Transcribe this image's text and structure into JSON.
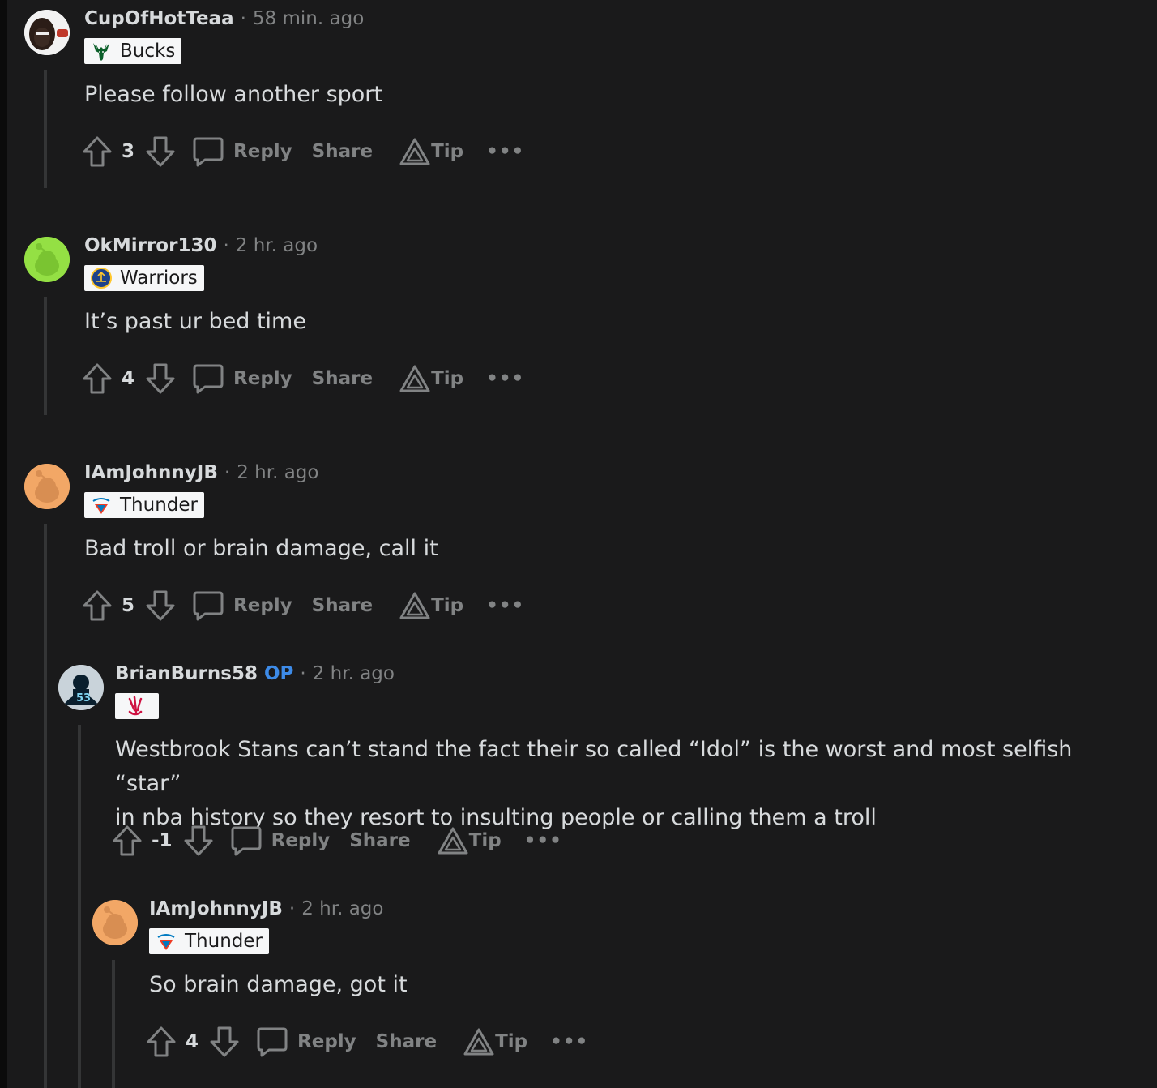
{
  "comments": [
    {
      "username": "CupOfHotTeaa",
      "time": "58 min. ago",
      "flair": "Bucks",
      "body": "Please follow another sport",
      "score": "3",
      "actions": {
        "reply": "Reply",
        "share": "Share",
        "tip": "Tip",
        "more": "•••"
      }
    },
    {
      "username": "OkMirror130",
      "time": "2 hr. ago",
      "flair": "Warriors",
      "body": "It’s past ur bed time",
      "score": "4",
      "actions": {
        "reply": "Reply",
        "share": "Share",
        "tip": "Tip",
        "more": "•••"
      }
    },
    {
      "username": "IAmJohnnyJB",
      "time": "2 hr. ago",
      "flair": "Thunder",
      "body": "Bad troll or brain damage, call it",
      "score": "5",
      "actions": {
        "reply": "Reply",
        "share": "Share",
        "tip": "Tip",
        "more": "•••"
      }
    },
    {
      "username": "BrianBurns58",
      "op_badge": "OP",
      "time": "2 hr. ago",
      "flair": "",
      "body_line1": "Westbrook Stans can’t stand the fact their so called “Idol” is the worst and most selfish “star”",
      "body_line2": "in nba history so they resort to insulting people or calling them a troll",
      "score": "-1",
      "actions": {
        "reply": "Reply",
        "share": "Share",
        "tip": "Tip",
        "more": "•••"
      }
    },
    {
      "username": "IAmJohnnyJB",
      "time": "2 hr. ago",
      "flair": "Thunder",
      "body": "So brain damage, got it",
      "score": "4",
      "actions": {
        "reply": "Reply",
        "share": "Share",
        "tip": "Tip",
        "more": "•••"
      }
    }
  ],
  "separator": "·",
  "colors": {
    "background": "#1a1a1b",
    "text": "#d7dadc",
    "muted": "#818384",
    "op": "#3d8be8",
    "flair_bg": "#f6f7f8"
  }
}
